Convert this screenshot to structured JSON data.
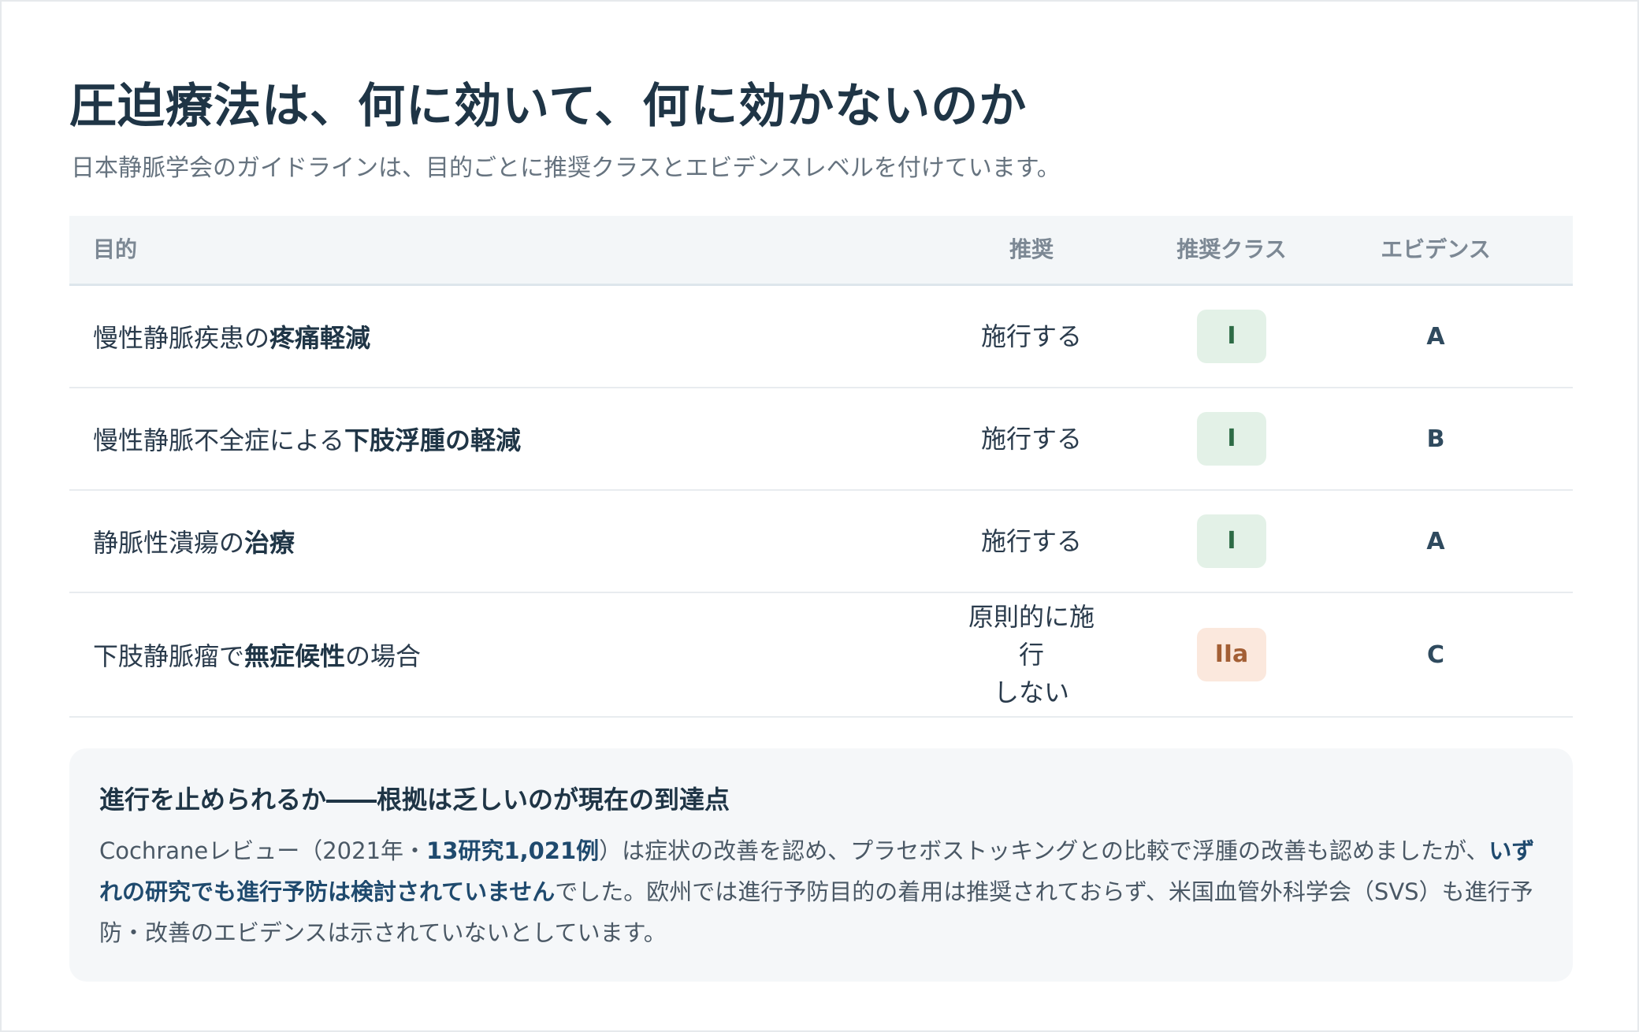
{
  "title": "圧迫療法は、何に効いて、何に効かないのか",
  "subtitle": "日本静脈学会のガイドラインは、目的ごとに推奨クラスとエビデンスレベルを付けています。",
  "table": {
    "headers": {
      "purpose": "目的",
      "recommendation": "推奨",
      "class": "推奨クラス",
      "evidence": "エビデンス"
    },
    "rows": [
      {
        "purpose_plain": "慢性静脈疾患の",
        "purpose_bold": "疼痛軽減",
        "purpose_tail": "",
        "recommendation": "施行する",
        "class": "I",
        "class_color": "#e3f1e7",
        "evidence": "A"
      },
      {
        "purpose_plain": "慢性静脈不全症による",
        "purpose_bold": "下肢浮腫の軽減",
        "purpose_tail": "",
        "recommendation": "施行する",
        "class": "I",
        "class_color": "#e3f1e7",
        "evidence": "B"
      },
      {
        "purpose_plain": "静脈性潰瘍の",
        "purpose_bold": "治療",
        "purpose_tail": "",
        "recommendation": "施行する",
        "class": "I",
        "class_color": "#e3f1e7",
        "evidence": "A"
      },
      {
        "purpose_plain": "下肢静脈瘤で",
        "purpose_bold": "無症候性",
        "purpose_tail": "の場合",
        "recommendation_line1": "原則的に施行",
        "recommendation_line2": "しない",
        "class": "IIa",
        "class_color": "#fbe8dd",
        "evidence": "C"
      }
    ]
  },
  "note": {
    "title": "進行を止められるか――根拠は乏しいのが現在の到達点",
    "body_1": "Cochraneレビュー（2021年・",
    "body_hl_1": "13研究1,021例",
    "body_2": "）は症状の改善を認め、プラセボストッキングとの比較で浮腫の改善も認めましたが、",
    "body_hl_2": "いずれの研究でも進行予防は検討されていません",
    "body_3": "でした。欧州では進行予防目的の着用は推奨されておらず、米国血管外科学会（SVS）も進行予防・改善のエビデンスは示されていないとしています。"
  }
}
